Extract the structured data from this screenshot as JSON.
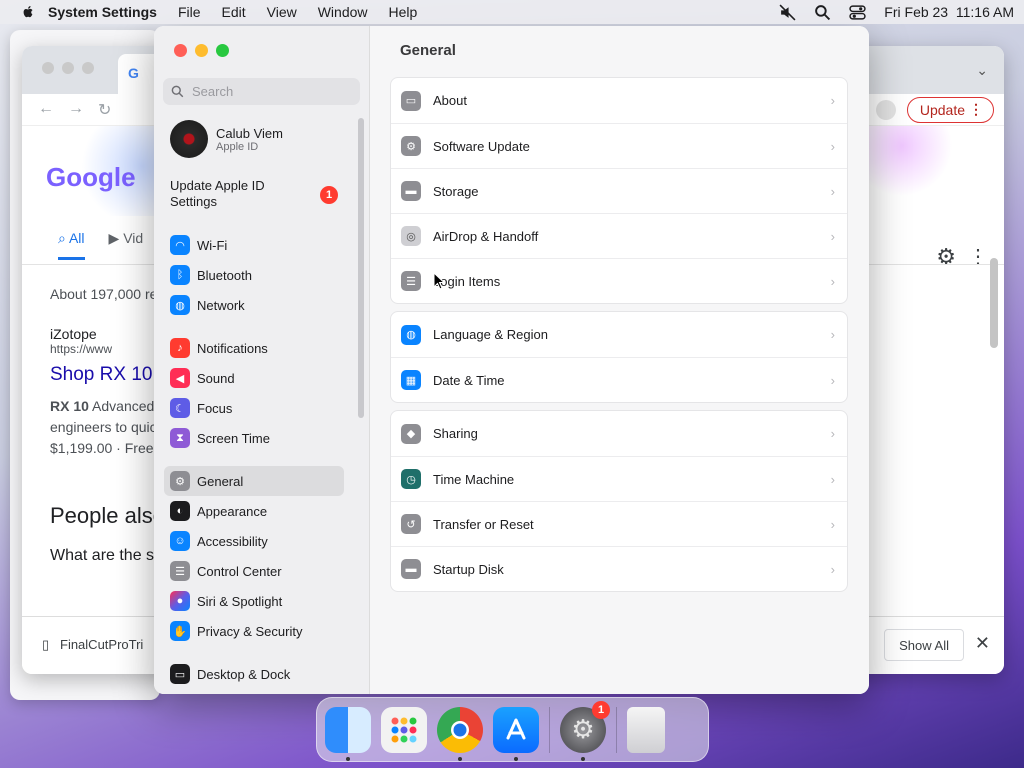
{
  "menubar": {
    "app_name": "System Settings",
    "menus": [
      "File",
      "Edit",
      "View",
      "Window",
      "Help"
    ],
    "datetime": "Fri Feb 23  11:16 AM"
  },
  "chrome": {
    "tab_icon_letter": "G",
    "update_label": "Update",
    "google_logo": "Google",
    "tab_all": "All",
    "tab_videos": "Vid",
    "results_count": "About 197,000 re",
    "site_name": "iZotope",
    "site_url": "https://www",
    "result_title": "Shop RX 10",
    "snippet_bold": "RX 10",
    "snippet_line1": " Advanced",
    "snippet_line2": "engineers to quic",
    "snippet_price": "$1,199.00 · Free",
    "people_also": "People also",
    "question": "What are the s",
    "download_file": "FinalCutProTri",
    "show_all": "Show All"
  },
  "settings": {
    "search_placeholder": "Search",
    "account_name": "Calub Viem",
    "account_sub": "Apple ID",
    "update_id_label": "Update Apple ID Settings",
    "update_badge": "1",
    "main_title": "General",
    "sidebar_items": [
      {
        "label": "Wi-Fi",
        "icon": "wifi-icon",
        "color": "#0a84ff"
      },
      {
        "label": "Bluetooth",
        "icon": "bluetooth-icon",
        "color": "#0a84ff"
      },
      {
        "label": "Network",
        "icon": "globe-icon",
        "color": "#0a84ff"
      },
      {
        "label": "Notifications",
        "icon": "bell-icon",
        "color": "#ff3b30"
      },
      {
        "label": "Sound",
        "icon": "speaker-icon",
        "color": "#ff2d55"
      },
      {
        "label": "Focus",
        "icon": "moon-icon",
        "color": "#5e5ce6"
      },
      {
        "label": "Screen Time",
        "icon": "hourglass-icon",
        "color": "#8e5bd6"
      },
      {
        "label": "General",
        "icon": "gear-icon",
        "color": "#8e8e93"
      },
      {
        "label": "Appearance",
        "icon": "appearance-icon",
        "color": "#1c1c1e"
      },
      {
        "label": "Accessibility",
        "icon": "accessibility-icon",
        "color": "#0a84ff"
      },
      {
        "label": "Control Center",
        "icon": "control-center-icon",
        "color": "#8e8e93"
      },
      {
        "label": "Siri & Spotlight",
        "icon": "siri-icon",
        "color": "#5e5ce6"
      },
      {
        "label": "Privacy & Security",
        "icon": "hand-icon",
        "color": "#0a84ff"
      },
      {
        "label": "Desktop & Dock",
        "icon": "dock-icon",
        "color": "#1c1c1e"
      }
    ],
    "groups": [
      [
        {
          "label": "About",
          "icon": "laptop-icon"
        },
        {
          "label": "Software Update",
          "icon": "gear-badge-icon"
        },
        {
          "label": "Storage",
          "icon": "drive-icon"
        },
        {
          "label": "AirDrop & Handoff",
          "icon": "airdrop-icon"
        },
        {
          "label": "Login Items",
          "icon": "list-icon"
        }
      ],
      [
        {
          "label": "Language & Region",
          "icon": "globe-icon"
        },
        {
          "label": "Date & Time",
          "icon": "calendar-icon"
        }
      ],
      [
        {
          "label": "Sharing",
          "icon": "sharing-icon"
        },
        {
          "label": "Time Machine",
          "icon": "time-machine-icon"
        },
        {
          "label": "Transfer or Reset",
          "icon": "reset-icon"
        },
        {
          "label": "Startup Disk",
          "icon": "disk-icon"
        }
      ]
    ]
  },
  "dock": {
    "apps": [
      "Finder",
      "Launchpad",
      "Google Chrome",
      "App Store",
      "System Settings",
      "Trash"
    ],
    "settings_badge": "1"
  }
}
